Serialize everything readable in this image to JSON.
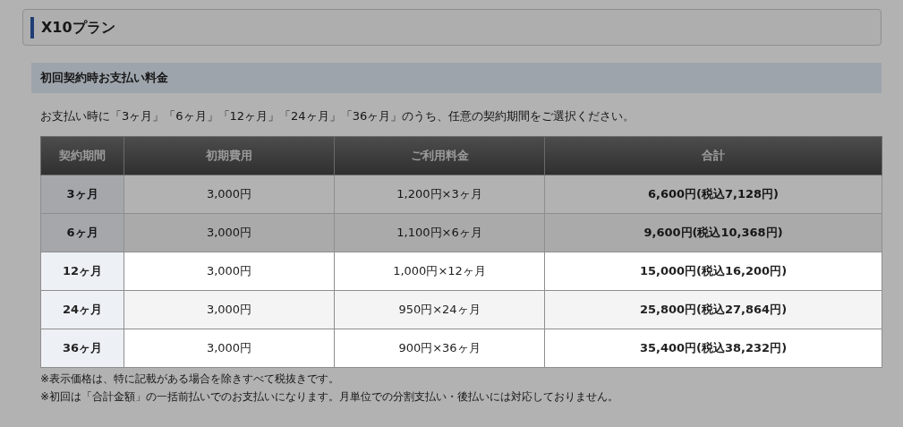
{
  "title": "X10プラン",
  "section": {
    "heading": "初回契約時お支払い料金",
    "intro": "お支払い時に「3ヶ月」「6ヶ月」「12ヶ月」「24ヶ月」「36ヶ月」のうち、任意の契約期間をご選択ください。"
  },
  "table": {
    "columns": [
      "契約期間",
      "初期費用",
      "ご利用料金",
      "合計"
    ],
    "rows": [
      {
        "cells": [
          "3ヶ月",
          "3,000円",
          "1,200円×3ヶ月",
          "6,600円(税込7,128円)"
        ],
        "highlighted": false
      },
      {
        "cells": [
          "6ヶ月",
          "3,000円",
          "1,100円×6ヶ月",
          "9,600円(税込10,368円)"
        ],
        "highlighted": false
      },
      {
        "cells": [
          "12ヶ月",
          "3,000円",
          "1,000円×12ヶ月",
          "15,000円(税込16,200円)"
        ],
        "highlighted": true
      },
      {
        "cells": [
          "24ヶ月",
          "3,000円",
          "950円×24ヶ月",
          "25,800円(税込27,864円)"
        ],
        "highlighted": true
      },
      {
        "cells": [
          "36ヶ月",
          "3,000円",
          "900円×36ヶ月",
          "35,400円(税込38,232円)"
        ],
        "highlighted": true
      }
    ]
  },
  "notes": [
    "※表示価格は、特に記載がある場合を除きすべて税抜きです。",
    "※初回は「合計金額」の一括前払いでのお支払いになります。月単位での分割支払い・後払いには対応しておりません。"
  ]
}
